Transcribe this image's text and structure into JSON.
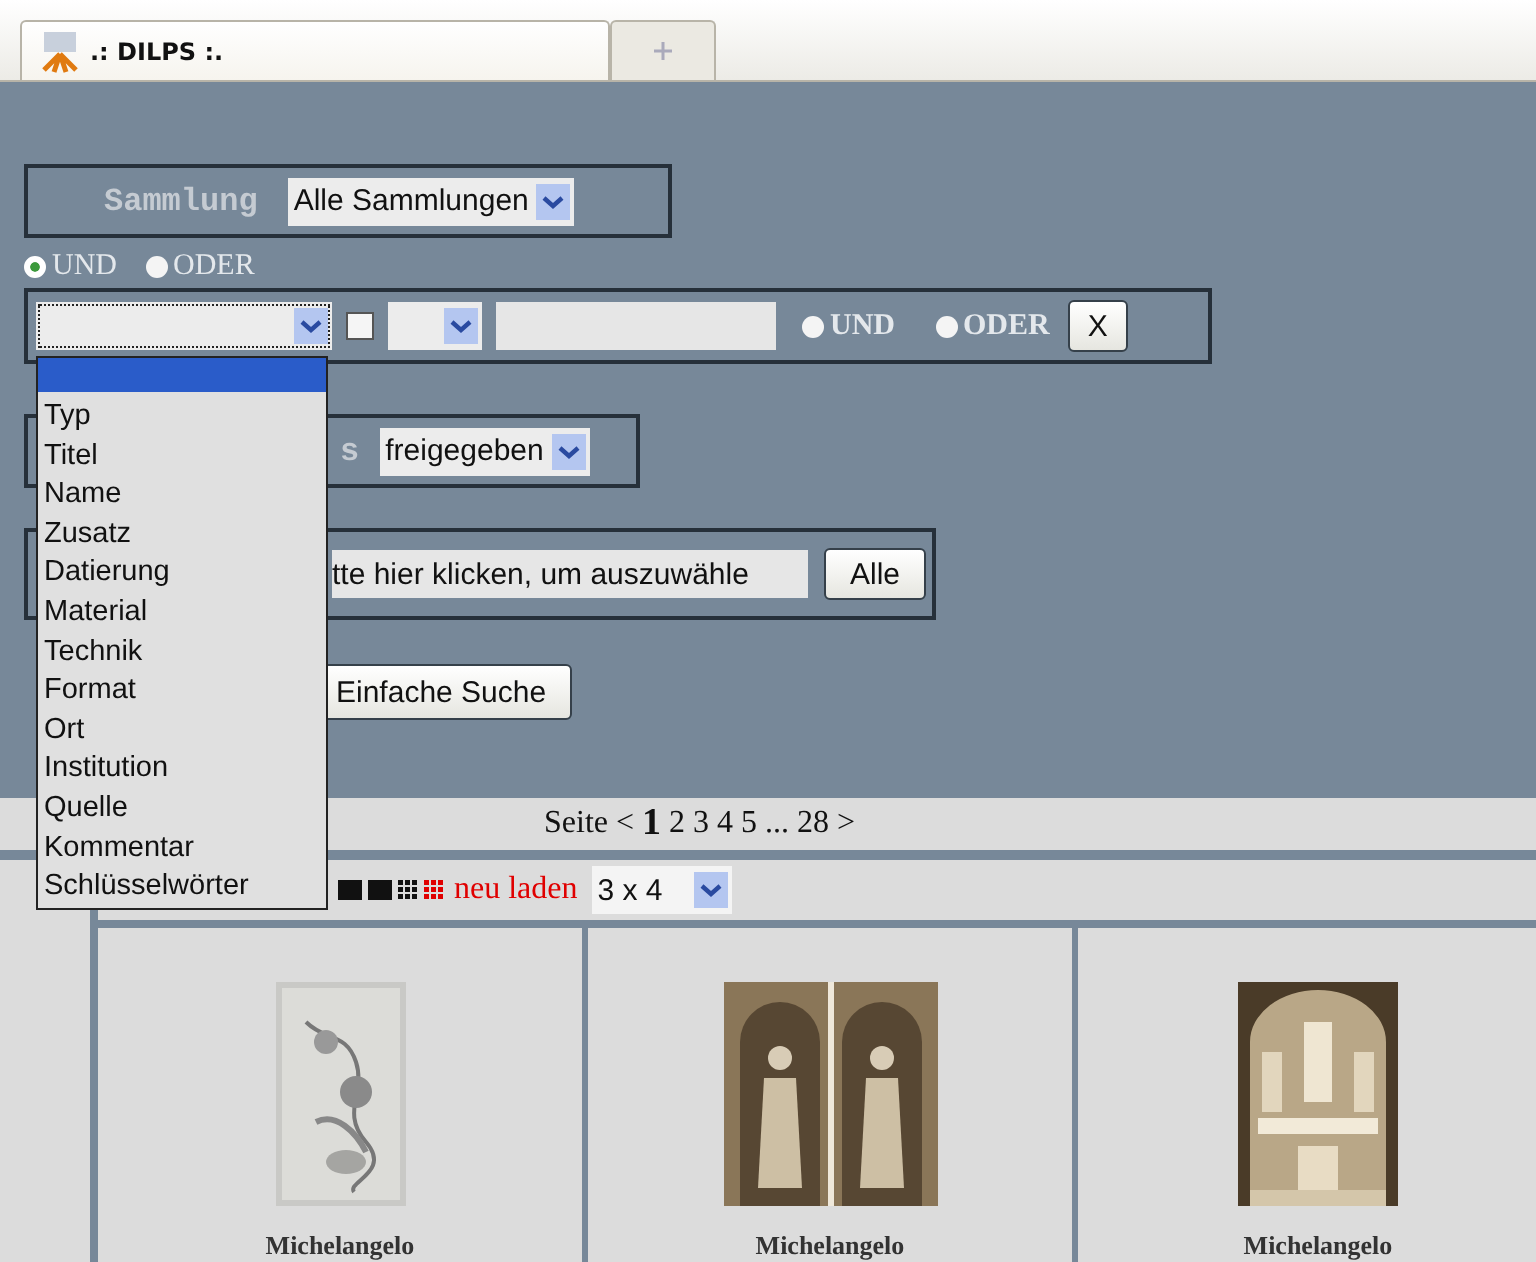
{
  "browser_tabs": [
    {
      "title": ".: DILPS :.",
      "selected": true
    },
    {
      "kind": "new"
    }
  ],
  "collection": {
    "label": "Sammlung",
    "value": "Alle Sammlungen"
  },
  "mode_radios": [
    {
      "label": "UND",
      "selected": true
    },
    {
      "label": "ODER",
      "selected": false
    }
  ],
  "criterion": {
    "checked": false,
    "radios": [
      {
        "label": "UND",
        "selected": false
      },
      {
        "label": "ODER",
        "selected": false
      }
    ],
    "remove_button": "X"
  },
  "field_options": [
    {
      "selected": true
    },
    {
      "label": "Typ",
      "selected": false
    },
    {
      "label": "Titel",
      "selected": false
    },
    {
      "label": "Name",
      "selected": false
    },
    {
      "label": "Zusatz",
      "selected": false
    },
    {
      "label": "Datierung",
      "selected": false
    },
    {
      "label": "Material",
      "selected": false
    },
    {
      "label": "Technik",
      "selected": false
    },
    {
      "label": "Format",
      "selected": false
    },
    {
      "label": "Ort",
      "selected": false
    },
    {
      "label": "Institution",
      "selected": false
    },
    {
      "label": "Quelle",
      "selected": false
    },
    {
      "label": "Kommentar",
      "selected": false
    },
    {
      "label": "Schlüsselwörter",
      "selected": false
    }
  ],
  "status": {
    "label": "s",
    "value": "freigegeben"
  },
  "group": {
    "value": "tte hier klicken, um auszuwähle",
    "button": "Alle"
  },
  "search_button": "Einfache Suche",
  "pagination": {
    "label": "Seite",
    "prev": "<",
    "pages": [
      {
        "label": "1",
        "selected": true
      },
      {
        "label": "2",
        "selected": false
      },
      {
        "label": "3",
        "selected": false
      },
      {
        "label": "4",
        "selected": false
      },
      {
        "label": "5",
        "selected": false
      }
    ],
    "ellipsis": "...",
    "last": "28",
    "next": ">"
  },
  "view_toolbar": {
    "reload": "neu laden",
    "grid_value": "3 x 4"
  },
  "results": [
    {
      "caption": "Michelangelo"
    },
    {
      "caption": "Michelangelo"
    },
    {
      "caption": "Michelangelo"
    }
  ]
}
